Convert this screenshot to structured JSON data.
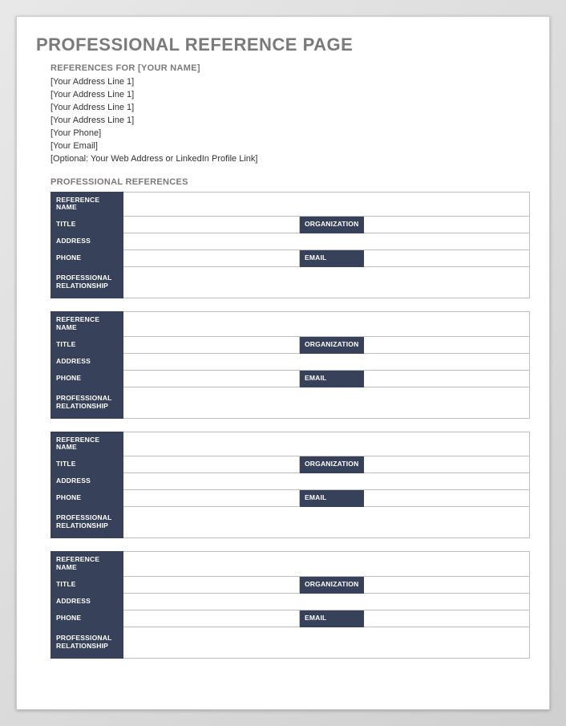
{
  "page_title": "PROFESSIONAL REFERENCE PAGE",
  "references_for_label": "REFERENCES FOR [YOUR NAME]",
  "address_lines": [
    "[Your Address Line 1]",
    "[Your Address Line 1]",
    "[Your Address Line 1]",
    "[Your Address Line 1]",
    "[Your Phone]",
    "[Your Email]",
    "[Optional: Your Web Address or LinkedIn Profile Link]"
  ],
  "section_title": "PROFESSIONAL REFERENCES",
  "field_labels": {
    "reference_name": "REFERENCE NAME",
    "title": "TITLE",
    "organization": "ORGANIZATION",
    "address": "ADDRESS",
    "phone": "PHONE",
    "email": "EMAIL",
    "professional_relationship": "PROFESSIONAL RELATIONSHIP"
  },
  "reference_entries": [
    {
      "reference_name": "",
      "title": "",
      "organization": "",
      "address": "",
      "phone": "",
      "email": "",
      "professional_relationship": ""
    },
    {
      "reference_name": "",
      "title": "",
      "organization": "",
      "address": "",
      "phone": "",
      "email": "",
      "professional_relationship": ""
    },
    {
      "reference_name": "",
      "title": "",
      "organization": "",
      "address": "",
      "phone": "",
      "email": "",
      "professional_relationship": ""
    },
    {
      "reference_name": "",
      "title": "",
      "organization": "",
      "address": "",
      "phone": "",
      "email": "",
      "professional_relationship": ""
    }
  ]
}
